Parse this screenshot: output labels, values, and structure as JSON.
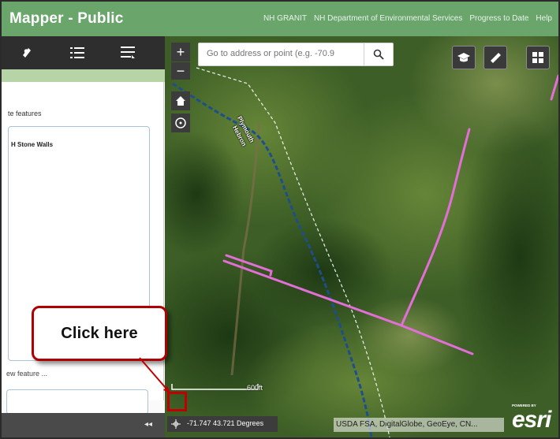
{
  "header": {
    "title": "Mapper - Public",
    "links": [
      "NH GRANIT",
      "NH Department of Environmental Services",
      "Progress to Date",
      "Help"
    ]
  },
  "left_panel": {
    "select_text": "te features",
    "layer_name": "H Stone Walls",
    "new_feature_text": "ew feature ...",
    "collapse_icon": "double-chevron-left-icon"
  },
  "map": {
    "search_placeholder": "Go to address or point (e.g. -70.9",
    "zoom_in_label": "+",
    "zoom_out_label": "−",
    "town_labels": [
      "Plymouth",
      "Hebron"
    ],
    "scale_label": "600ft",
    "coordinates": "-71.747 43.721 Degrees",
    "attribution": "USDA FSA, DigitalGlobe, GeoEye, CN...",
    "logo_powered": "POWERED BY",
    "logo_text": "esri"
  },
  "callout": {
    "text": "Click here"
  },
  "colors": {
    "header": "#6aa56c",
    "toolbar": "#2e2e2e",
    "accent_green": "#b7d4a6",
    "stone_wall": "#e36ed8",
    "callout_border": "#b00000"
  }
}
